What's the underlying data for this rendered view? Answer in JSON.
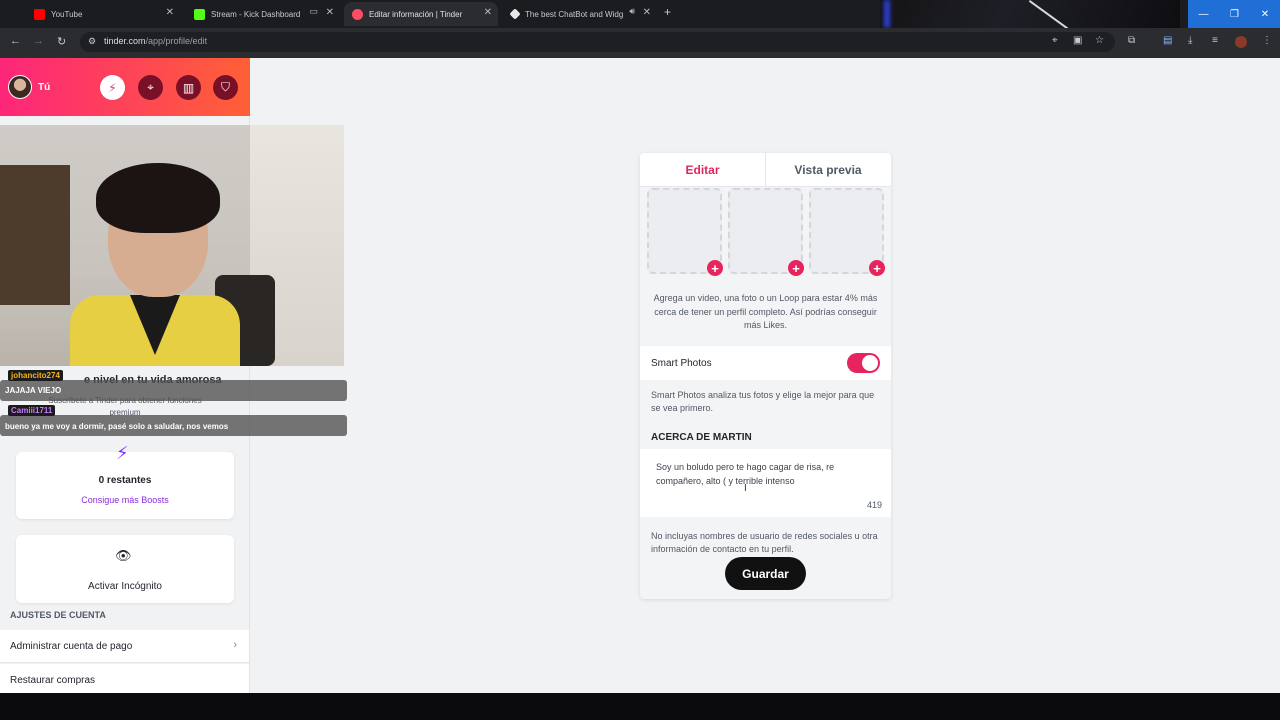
{
  "browser": {
    "tabs": [
      {
        "title": "YouTube",
        "color": "#ff0000"
      },
      {
        "title": "Stream - Kick Dashboard",
        "color": "#53fc18"
      },
      {
        "title": "Editar información | Tinder",
        "color": "#fd4d64"
      },
      {
        "title": "The best ChatBot and Widg",
        "color": "#e8e8e8"
      }
    ],
    "url_host": "tinder.com",
    "url_path": "/app/profile/edit"
  },
  "sidebar": {
    "user_label": "Tú",
    "header_icons": [
      "bolt-icon",
      "compass-icon",
      "briefcase-icon",
      "shield-icon"
    ],
    "upgrade_title": "e nivel en tu vida amorosa",
    "upgrade_sub": "Suscríbete a Tinder para obtener funciones premium",
    "boost_count": "0 restantes",
    "boost_link": "Consigue más Boosts",
    "incognito_label": "Activar Incógnito",
    "account_section": "AJUSTES DE CUENTA",
    "account_items": [
      "Administrar cuenta de pago",
      "Restaurar compras"
    ]
  },
  "chat": [
    {
      "user": "johancito274",
      "user_color": "#f5b323",
      "message": "JAJAJA VIEJO"
    },
    {
      "user": "Camiii1711",
      "user_color": "#c77dff",
      "message": "bueno ya me voy a dormir, pasé solo a saludar, nos vemos"
    }
  ],
  "editor": {
    "tab_edit": "Editar",
    "tab_preview": "Vista previa",
    "media_hint": "Agrega un video, una foto o un Loop para estar 4% más cerca de tener un perfil completo. Así podrías conseguir más Likes.",
    "smart_photos_label": "Smart Photos",
    "smart_photos_enabled": true,
    "smart_photos_desc": "Smart Photos analiza tus fotos y elige la mejor para que se vea primero.",
    "about_title": "ACERCA DE MARTIN",
    "bio": "Soy un boludo pero te hago cagar de risa, re compañero, alto ( y terrible intenso",
    "bio_remaining": "419",
    "warning": "No incluyas nombres de usuario de redes sociales u otra información de contacto en tu perfil.",
    "save_label": "Guardar"
  },
  "colors": {
    "brand_gradient_start": "#fd267a",
    "brand_gradient_end": "#ff6036",
    "accent": "#e8245f"
  }
}
